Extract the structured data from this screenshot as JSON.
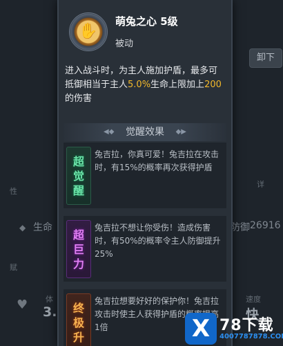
{
  "background": {
    "unload_label": "卸下",
    "life_label": "生命",
    "defense_label": "防御",
    "defense_value": "26916",
    "hp_short": "体",
    "hp_value": "3.",
    "speed_label": "速度",
    "speed_value": "快",
    "detail_label": "详",
    "attr_label": "性",
    "misc_label": "赋"
  },
  "skill": {
    "name": "萌兔之心 5级",
    "type": "被动",
    "desc_1": "进入战斗时，为主人施加护盾，最多可抵御相当于主人",
    "desc_pct": "5.0%",
    "desc_2": "生命上限加上",
    "desc_num": "200",
    "desc_3": "的伤害",
    "icon": "paw-icon"
  },
  "awakening": {
    "title": "觉醒效果",
    "items": [
      {
        "badge": [
          "超",
          "觉",
          "醒"
        ],
        "color": "green",
        "text": "兔吉拉，你真可爱！兔吉拉在攻击时，有15%的概率再次获得护盾"
      },
      {
        "badge": [
          "超",
          "巨",
          "力"
        ],
        "color": "purple",
        "text": "兔吉拉不想让你受伤！造成伤害时，有50%的概率令主人防御提升25%"
      },
      {
        "badge": [
          "终",
          "极",
          "升"
        ],
        "color": "orange",
        "text": "兔吉拉想要好好的保护你！兔吉拉攻击时使主人获得护盾的概率提高1倍"
      }
    ]
  },
  "watermark": {
    "logo": "X",
    "top": "78下载",
    "bottom": "4007787878.COM"
  }
}
